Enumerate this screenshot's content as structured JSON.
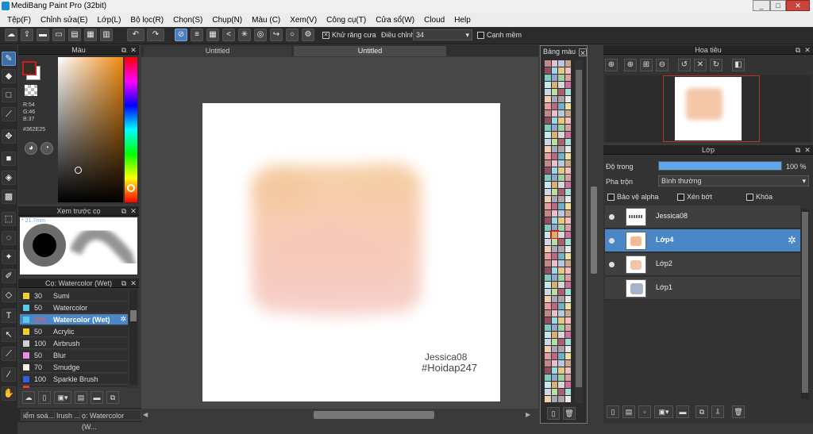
{
  "window": {
    "title": "MediBang Paint Pro (32bit)",
    "minimize": "_",
    "maximize": "□",
    "close": "✕"
  },
  "menu": [
    "Tệp(F)",
    "Chỉnh sửa(E)",
    "Lớp(L)",
    "Bộ lọc(R)",
    "Chọn(S)",
    "Chụp(N)",
    "Màu (C)",
    "Xem(V)",
    "Công cụ(T)",
    "Cửa sổ(W)",
    "Cloud",
    "Help"
  ],
  "toolbar": {
    "antialias_label": "Khử răng cưa",
    "adjust_label": "Điều chỉnh",
    "adjust_value": "34",
    "edge_label": "Cạnh mềm"
  },
  "color_panel": {
    "title": "Màu",
    "r": "R:54",
    "g": "G:46",
    "b": "B:37",
    "hex": "#362E25"
  },
  "preview_panel": {
    "title": "Xem trước cọ",
    "size": "21.7mm"
  },
  "brush_panel": {
    "title": "Cọ: Watercolor (Wet)",
    "items": [
      {
        "size": "30",
        "name": "Sumi",
        "color": "#f0d020"
      },
      {
        "size": "50",
        "name": "Watercolor",
        "color": "#5bc8f0"
      },
      {
        "size": "300",
        "name": "Watercolor (Wet)",
        "color": "#5bc8f0"
      },
      {
        "size": "50",
        "name": "Acrylic",
        "color": "#f0d020"
      },
      {
        "size": "100",
        "name": "Airbrush",
        "color": "#d0d0d0"
      },
      {
        "size": "50",
        "name": "Blur",
        "color": "#e890e8"
      },
      {
        "size": "70",
        "name": "Smudge",
        "color": "#f8f0e0"
      },
      {
        "size": "100",
        "name": "Sparkle Brush",
        "color": "#3060e0"
      },
      {
        "size": "",
        "name": "",
        "color": "#e04040"
      }
    ]
  },
  "status_tabs": [
    "iểm soá...",
    "Irush ...",
    "ọ: Watercolor (W..."
  ],
  "doc_tabs": [
    "Untitled",
    "Untitled"
  ],
  "canvas": {
    "signature_line1": "Jessica08",
    "signature_line2": "#Hoidap247"
  },
  "palette": {
    "title": "Bảng màu"
  },
  "navigator": {
    "title": "Hoa tiêu"
  },
  "layers": {
    "title": "Lớp",
    "opacity_label": "Độ trong",
    "opacity_value": "100 %",
    "opacity_fraction": 1.0,
    "blend_label": "Pha trộn",
    "blend_value": "Bình thường",
    "protect_alpha": "Bảo vệ alpha",
    "clip": "Xén bớt",
    "lock": "Khóa",
    "items": [
      {
        "name": "Jessica08"
      },
      {
        "name": "Lớp4"
      },
      {
        "name": "Lớp2"
      },
      {
        "name": "Lớp1"
      }
    ]
  },
  "colors": {
    "accent": "#4a87c7",
    "fg": "#c81e1e",
    "bg": "#ffffff"
  }
}
